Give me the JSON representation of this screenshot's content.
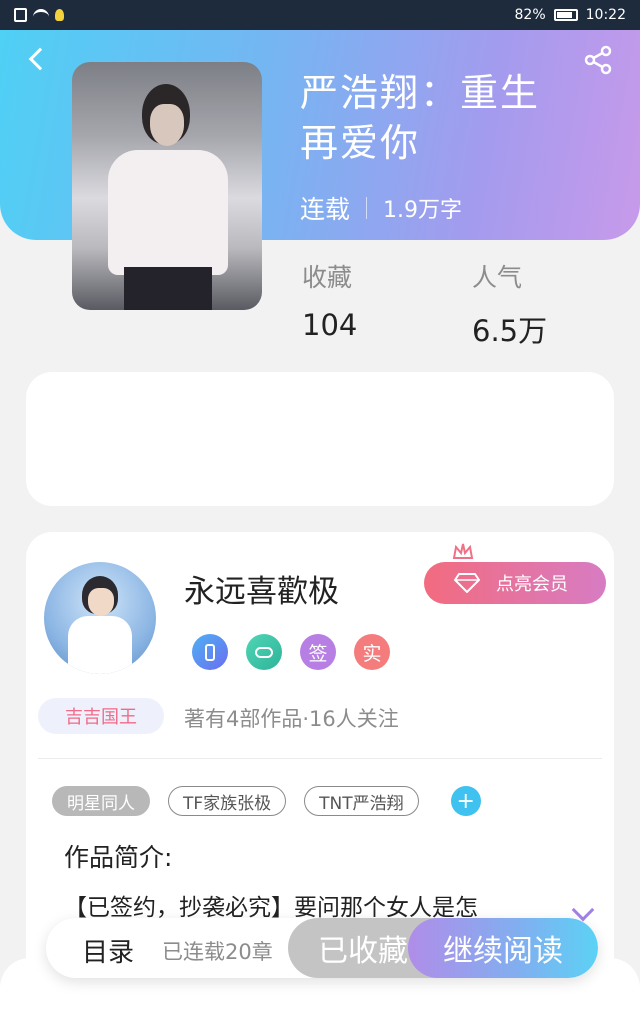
{
  "status_bar": {
    "battery": "82%",
    "time": "10:22"
  },
  "book": {
    "title_line1": "严浩翔：重生",
    "title_line2": "再爱你",
    "status": "连载",
    "word_count": "1.9万字",
    "stats": [
      {
        "label": "收藏",
        "value": "104"
      },
      {
        "label": "人气",
        "value": "6.5万"
      }
    ]
  },
  "author": {
    "name": "永远喜歡极",
    "vip_button": "点亮会员",
    "badges": {
      "sign": "签",
      "real": "实"
    },
    "level": "吉吉国王",
    "works_summary": "著有4部作品·16人关注"
  },
  "tags": [
    "明星同人",
    "TF家族张极",
    "TNT严浩翔"
  ],
  "add_tag": "+",
  "intro": {
    "heading": "作品简介:",
    "text": "【已签约，抄袭必究】要问那个女人是怎"
  },
  "bottom_bar": {
    "toc_label": "目录",
    "toc_status": "已连载20章",
    "collected_label": "已收藏",
    "read_label": "继续阅读"
  }
}
